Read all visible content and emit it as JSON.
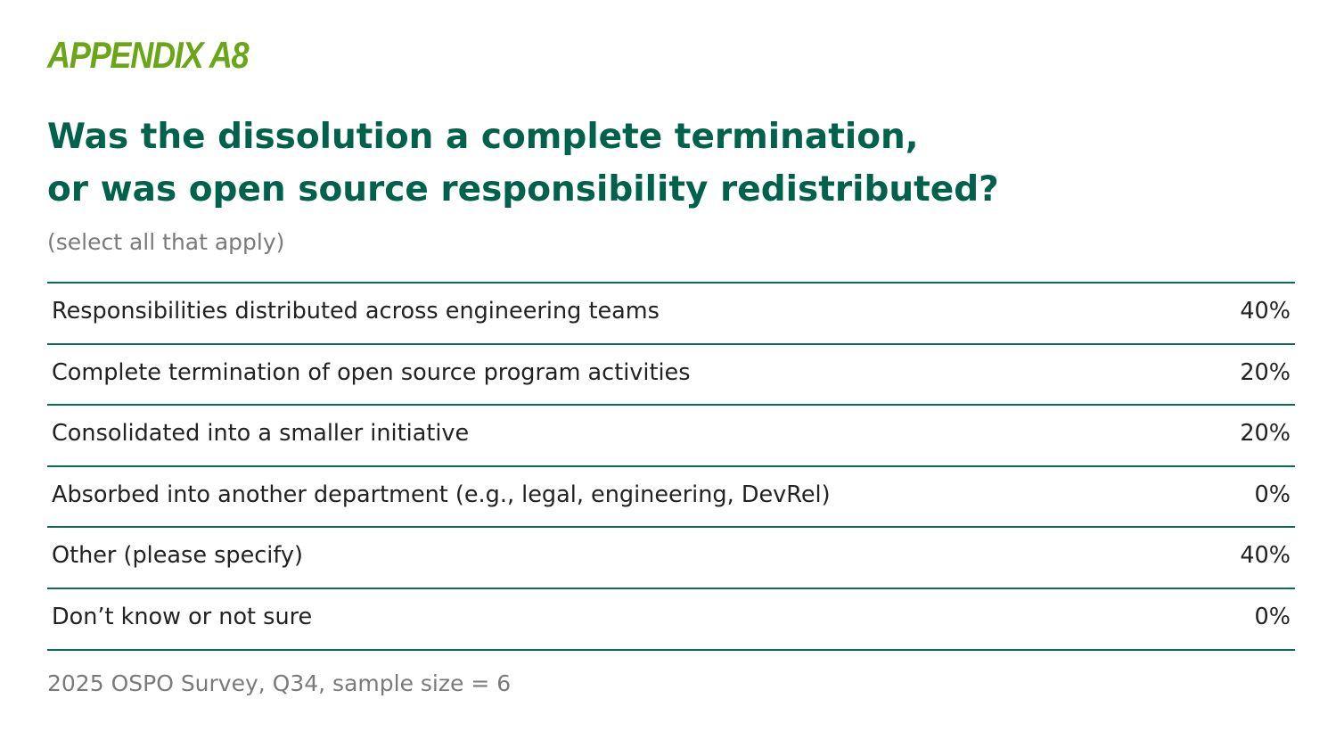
{
  "appendix_label": "APPENDIX A8",
  "title": {
    "line1": "Was the dissolution a complete termination,",
    "line2": "or was open source responsibility redistributed?"
  },
  "subtitle": "(select all that apply)",
  "colors": {
    "appendix": "#6aa617",
    "title": "#00624a",
    "rule": "#0d6b58",
    "muted": "#7a7a7a"
  },
  "chart_data": {
    "type": "table",
    "rows": [
      {
        "label": "Responsibilities distributed across engineering teams",
        "value": "40%"
      },
      {
        "label": "Complete termination of open source program activities",
        "value": "20%"
      },
      {
        "label": "Consolidated into a smaller initiative",
        "value": "20%"
      },
      {
        "label": "Absorbed into another department (e.g., legal, engineering, DevRel)",
        "value": "0%"
      },
      {
        "label": "Other (please specify)",
        "value": "40%"
      },
      {
        "label": "Don’t know or not sure",
        "value": "0%"
      }
    ]
  },
  "source": "2025 OSPO Survey, Q34, sample size = 6"
}
